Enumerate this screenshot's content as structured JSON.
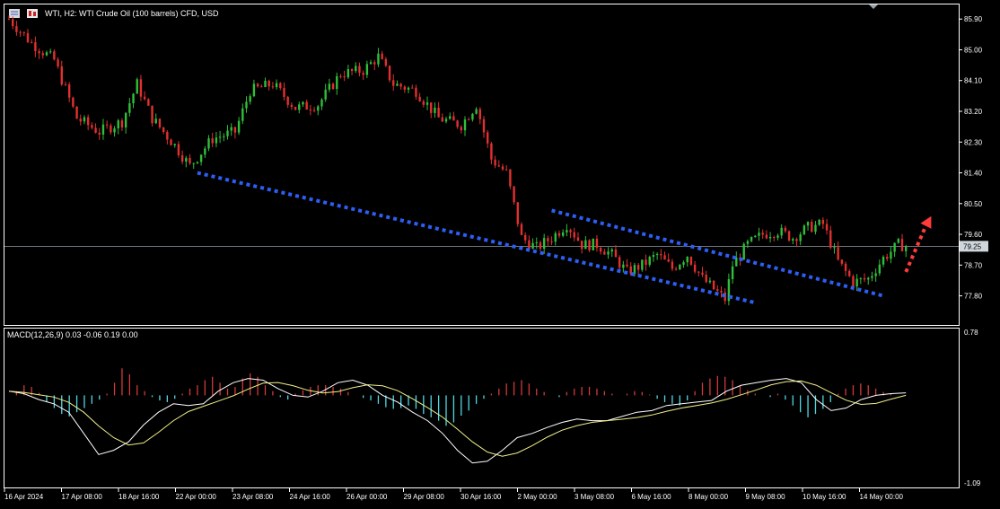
{
  "header": {
    "symbol_line": "WTI, H2:  WTI Crude Oil (100 barrels) CFD, USD",
    "icons": [
      "menu-icon",
      "chart-type-icon"
    ]
  },
  "colors": {
    "background": "#000000",
    "frame": "#ffffff",
    "bull": "#2fbf3a",
    "bear": "#e23030",
    "hist_pos": "#d23a3a",
    "hist_neg": "#4fd8e4",
    "macd_line": "#ffffff",
    "signal_line": "#f2f08a",
    "channel": "#2d5ef5",
    "arrow": "#ff3b3b",
    "price_line": "#8f9aa3"
  },
  "main": {
    "y_ticks": [
      "85.90",
      "85.00",
      "84.10",
      "83.20",
      "82.30",
      "81.40",
      "80.50",
      "79.60",
      "78.70",
      "77.80"
    ],
    "current_price": "79.25"
  },
  "macd": {
    "label": "MACD(12,26,9) 0.03 -0.06 0.19 0.00",
    "top_label": "0.78",
    "bottom_label": "-1.09"
  },
  "x_axis": {
    "labels": [
      "16 Apr 2024",
      "17 Apr 08:00",
      "18 Apr 16:00",
      "22 Apr 00:00",
      "23 Apr 08:00",
      "24 Apr 16:00",
      "26 Apr 00:00",
      "29 Apr 08:00",
      "30 Apr 16:00",
      "2 May 00:00",
      "3 May 08:00",
      "6 May 16:00",
      "8 May 00:00",
      "9 May 08:00",
      "10 May 16:00",
      "14 May 00:00"
    ]
  },
  "chart_data": {
    "type": "candlestick",
    "symbol": "WTI",
    "timeframe": "H2",
    "current_price": 79.25,
    "ylim": [
      77.0,
      86.3
    ],
    "close_path": [
      {
        "x": 0,
        "close": 85.9
      },
      {
        "x": 3,
        "close": 85.2
      },
      {
        "x": 6,
        "close": 84.7
      },
      {
        "x": 9,
        "close": 83.0
      },
      {
        "x": 12,
        "close": 82.6
      },
      {
        "x": 15,
        "close": 82.9
      },
      {
        "x": 17,
        "close": 84.0
      },
      {
        "x": 19,
        "close": 83.0
      },
      {
        "x": 22,
        "close": 82.2
      },
      {
        "x": 24,
        "close": 81.6
      },
      {
        "x": 27,
        "close": 82.4
      },
      {
        "x": 30,
        "close": 82.6
      },
      {
        "x": 32,
        "close": 83.8
      },
      {
        "x": 35,
        "close": 84.0
      },
      {
        "x": 38,
        "close": 83.3
      },
      {
        "x": 41,
        "close": 83.4
      },
      {
        "x": 44,
        "close": 84.3
      },
      {
        "x": 47,
        "close": 84.4
      },
      {
        "x": 49,
        "close": 84.8
      },
      {
        "x": 51,
        "close": 84.0
      },
      {
        "x": 54,
        "close": 83.8
      },
      {
        "x": 57,
        "close": 83.0
      },
      {
        "x": 60,
        "close": 82.8
      },
      {
        "x": 62,
        "close": 83.4
      },
      {
        "x": 64,
        "close": 81.8
      },
      {
        "x": 66,
        "close": 81.4
      },
      {
        "x": 68,
        "close": 79.5
      },
      {
        "x": 70,
        "close": 79.2
      },
      {
        "x": 72,
        "close": 79.5
      },
      {
        "x": 74,
        "close": 79.9
      },
      {
        "x": 76,
        "close": 79.3
      },
      {
        "x": 78,
        "close": 79.3
      },
      {
        "x": 80,
        "close": 79.0
      },
      {
        "x": 82,
        "close": 78.5
      },
      {
        "x": 84,
        "close": 78.7
      },
      {
        "x": 86,
        "close": 79.0
      },
      {
        "x": 88,
        "close": 78.6
      },
      {
        "x": 90,
        "close": 79.0
      },
      {
        "x": 92,
        "close": 78.3
      },
      {
        "x": 94,
        "close": 77.9
      },
      {
        "x": 95,
        "close": 77.7
      },
      {
        "x": 96,
        "close": 78.7
      },
      {
        "x": 98,
        "close": 79.3
      },
      {
        "x": 100,
        "close": 79.6
      },
      {
        "x": 102,
        "close": 79.7
      },
      {
        "x": 104,
        "close": 79.5
      },
      {
        "x": 106,
        "close": 79.8
      },
      {
        "x": 108,
        "close": 79.9
      },
      {
        "x": 110,
        "close": 78.8
      },
      {
        "x": 112,
        "close": 78.2
      },
      {
        "x": 114,
        "close": 78.3
      },
      {
        "x": 116,
        "close": 78.9
      },
      {
        "x": 118,
        "close": 79.3
      },
      {
        "x": 119,
        "close": 79.25
      }
    ],
    "channels": [
      {
        "from": {
          "x": 25,
          "y": 81.4
        },
        "to": {
          "x": 99,
          "y": 77.6
        }
      },
      {
        "from": {
          "x": 72,
          "y": 80.3
        },
        "to": {
          "x": 116,
          "y": 77.8
        }
      }
    ],
    "arrow": {
      "from": {
        "x": 119,
        "y": 78.5
      },
      "to": {
        "x": 122,
        "y": 80.0
      }
    },
    "macd": {
      "params": "12,26,9",
      "values": {
        "macd": 0.03,
        "signal": -0.06,
        "c": 0.19,
        "d": 0.0
      },
      "ylim": [
        -1.09,
        0.78
      ],
      "hist": [
        0.0,
        0.05,
        0.12,
        0.1,
        0.03,
        -0.08,
        -0.15,
        -0.22,
        -0.25,
        -0.2,
        -0.15,
        -0.1,
        -0.05,
        0.02,
        0.15,
        0.32,
        0.25,
        0.12,
        0.05,
        -0.02,
        -0.06,
        -0.08,
        -0.04,
        0.02,
        0.08,
        0.12,
        0.18,
        0.22,
        0.15,
        0.08,
        0.1,
        0.2,
        0.26,
        0.22,
        0.12,
        0.05,
        -0.02,
        -0.05,
        0.02,
        0.06,
        0.1,
        0.12,
        0.12,
        0.1,
        0.08,
        0.04,
        0.0,
        -0.03,
        -0.06,
        -0.1,
        -0.14,
        -0.16,
        -0.15,
        -0.12,
        -0.16,
        -0.22,
        -0.26,
        -0.3,
        -0.36,
        -0.32,
        -0.24,
        -0.18,
        -0.1,
        -0.04,
        0.02,
        0.08,
        0.14,
        0.16,
        0.18,
        0.14,
        0.08,
        0.04,
        0.0,
        -0.02,
        0.04,
        0.08,
        0.1,
        0.1,
        0.08,
        0.05,
        0.02,
        0.0,
        0.02,
        0.05,
        0.04,
        0.01,
        -0.04,
        -0.08,
        -0.1,
        -0.12,
        -0.06,
        0.05,
        0.15,
        0.2,
        0.23,
        0.22,
        0.18,
        0.12,
        0.06,
        0.02,
        0.0,
        -0.02,
        0.02,
        -0.05,
        -0.12,
        -0.2,
        -0.26,
        -0.22,
        -0.16,
        -0.08,
        0.02,
        0.08,
        0.12,
        0.14,
        0.12,
        0.08,
        0.04,
        0.02,
        0.0,
        0.0
      ],
      "macd_line": [
        0.05,
        0.02,
        -0.05,
        -0.1,
        -0.2,
        -0.45,
        -0.7,
        -0.65,
        -0.55,
        -0.35,
        -0.2,
        -0.1,
        -0.12,
        -0.1,
        0.05,
        0.15,
        0.2,
        0.18,
        0.08,
        0.0,
        -0.02,
        0.05,
        0.15,
        0.18,
        0.12,
        0.0,
        -0.08,
        -0.2,
        -0.3,
        -0.45,
        -0.65,
        -0.8,
        -0.78,
        -0.65,
        -0.5,
        -0.45,
        -0.38,
        -0.32,
        -0.28,
        -0.3,
        -0.3,
        -0.25,
        -0.2,
        -0.18,
        -0.12,
        -0.1,
        -0.08,
        -0.06,
        0.05,
        0.12,
        0.15,
        0.18,
        0.2,
        0.15,
        -0.05,
        -0.18,
        -0.15,
        -0.05,
        0.0,
        0.02,
        0.03
      ]
    }
  }
}
